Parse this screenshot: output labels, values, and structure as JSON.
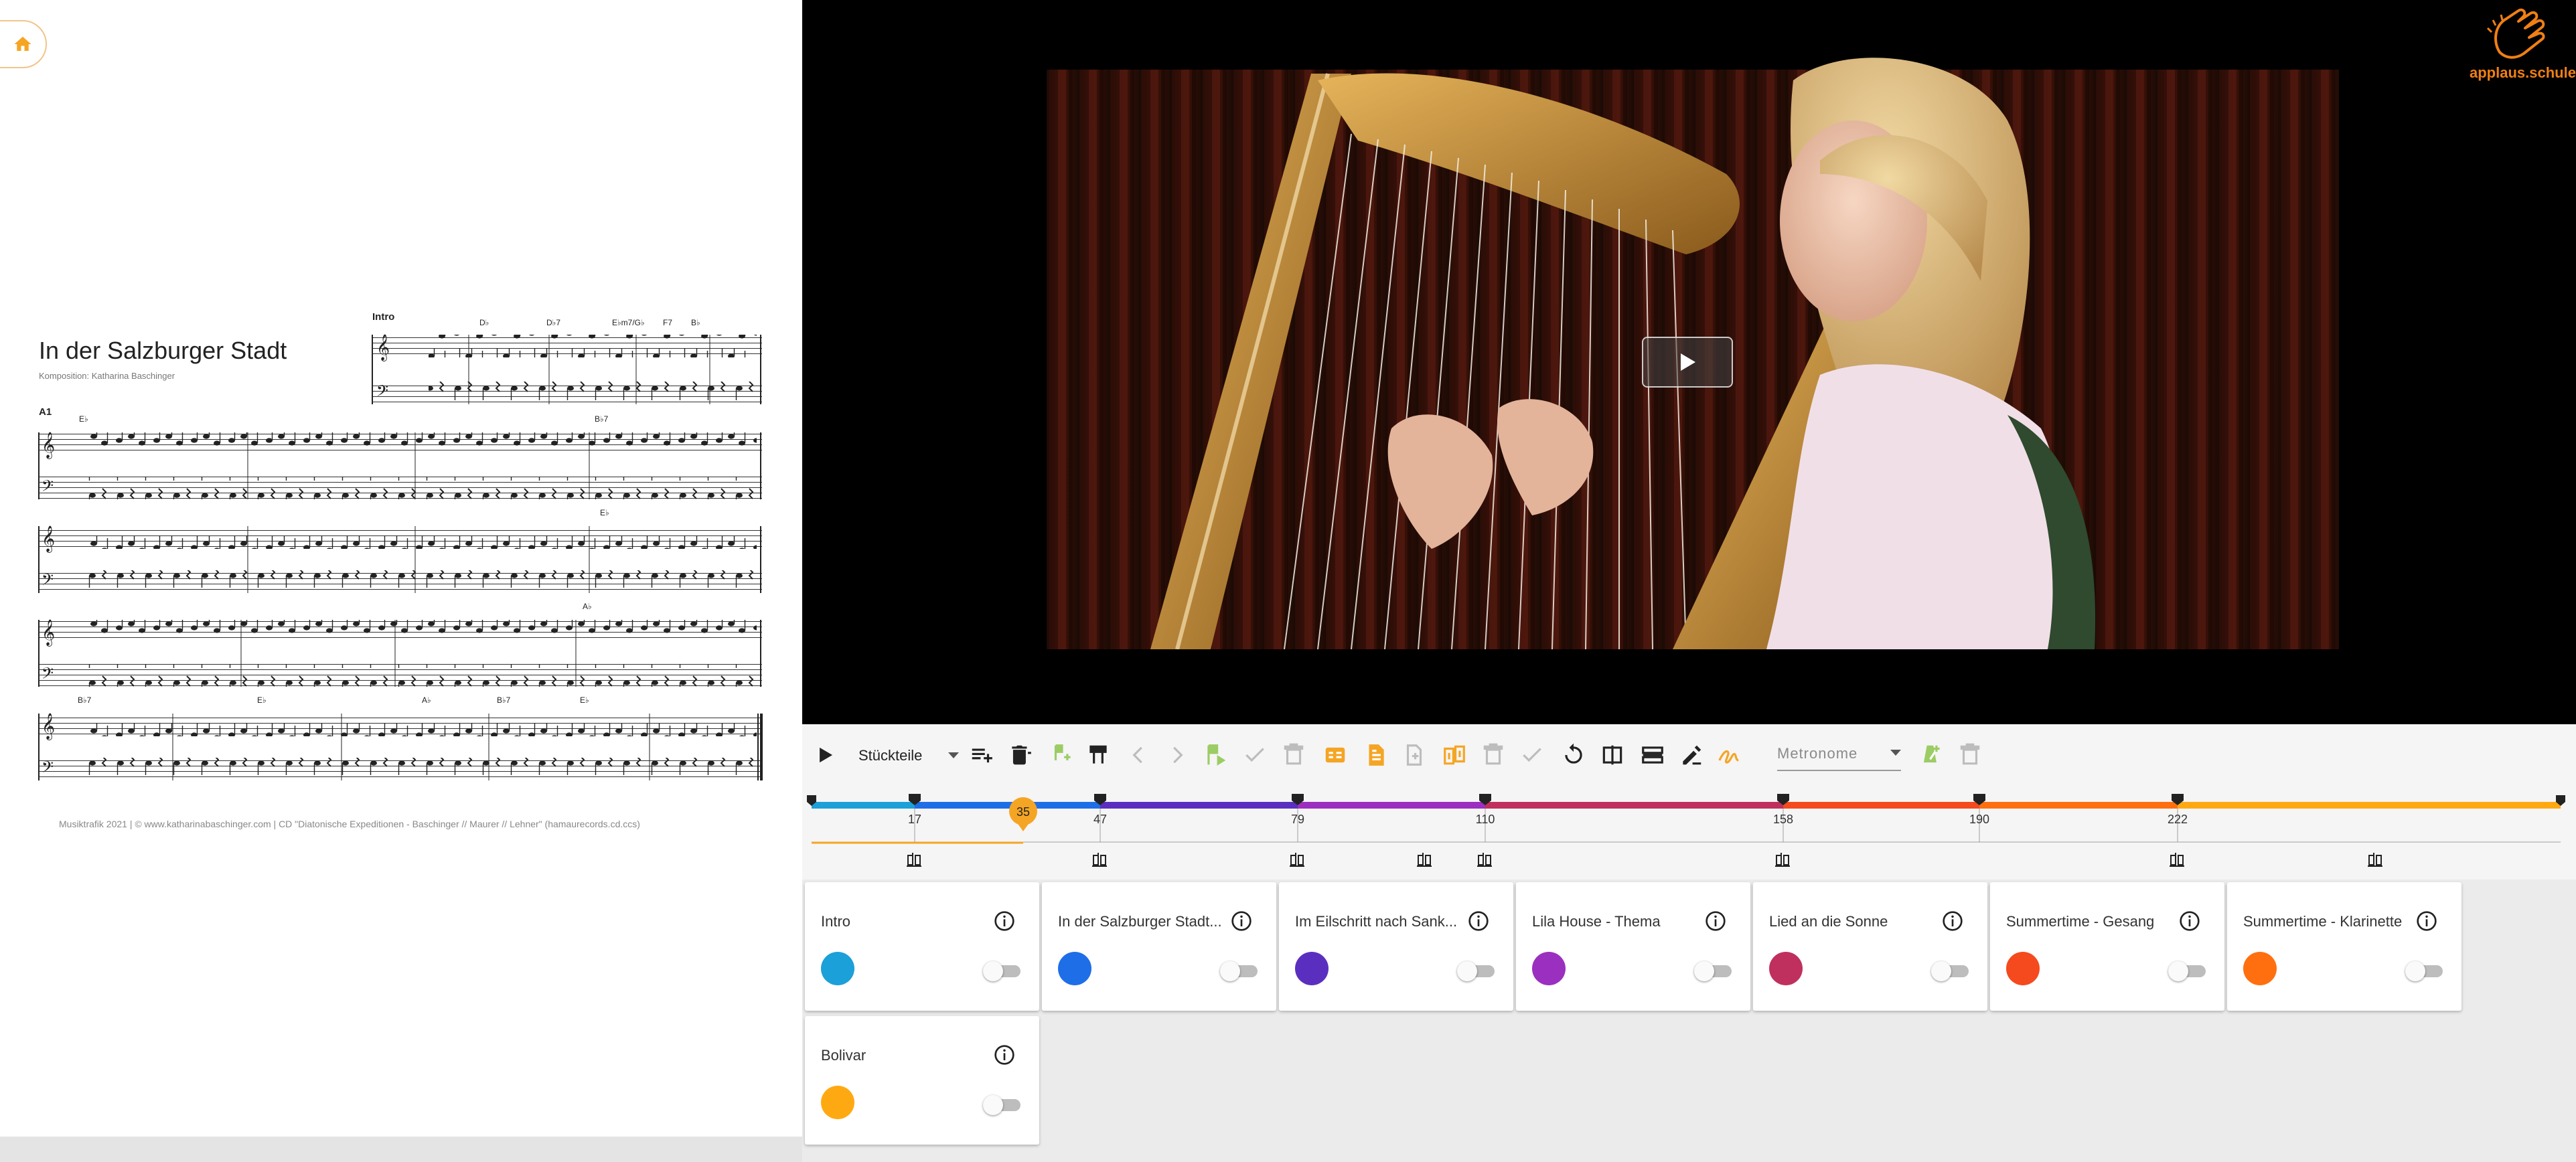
{
  "sheet": {
    "title": "In der Salzburger Stadt",
    "composer": "Komposition: Katharina Baschinger",
    "intro_label": "Intro",
    "section_label": "A1",
    "chords_intro": [
      "D♭",
      "D♭7",
      "E♭m7/G♭",
      "F7",
      "B♭"
    ],
    "chords_row1": [
      "E♭",
      "B♭7"
    ],
    "chords_row2": [
      "E♭"
    ],
    "chords_row3": [
      "A♭"
    ],
    "chords_row4": [
      "B♭7",
      "E♭",
      "A♭",
      "B♭7",
      "E♭"
    ],
    "footer": "Musiktrafik 2021 | © www.katharinabaschinger.com | CD \"Diatonische Expeditionen - Baschinger // Maurer // Lehner\" (hamaurecords.cd.ccs)"
  },
  "logo": {
    "text": "applaus.schule",
    "icon": "clapping-hands-icon",
    "color": "#f07f14"
  },
  "toolbar": {
    "parts_select": "Stückteile",
    "metronome_select": "Metronome"
  },
  "timeline": {
    "position_marker": "35",
    "ticks": [
      "17",
      "47",
      "79",
      "110",
      "158",
      "190",
      "222"
    ],
    "colors": [
      "#1ba0d9",
      "#1e6ee8",
      "#5a2fc0",
      "#9b2fc0",
      "#c0305e",
      "#f44a1e",
      "#ff6f10",
      "#ffa912"
    ]
  },
  "cards": [
    {
      "title": "Intro",
      "color": "#1ba0d9",
      "enabled": false
    },
    {
      "title": "In der Salzburger Stadt...",
      "color": "#1e6ee8",
      "enabled": false
    },
    {
      "title": "Im Eilschritt nach Sank...",
      "color": "#5a2fc0",
      "enabled": false
    },
    {
      "title": "Lila House - Thema",
      "color": "#9b2fc0",
      "enabled": false
    },
    {
      "title": "Lied an die Sonne",
      "color": "#c0305e",
      "enabled": false
    },
    {
      "title": "Summertime - Gesang",
      "color": "#f44a1e",
      "enabled": false
    },
    {
      "title": "Summertime - Klarinette",
      "color": "#ff6f10",
      "enabled": false
    },
    {
      "title": "Bolivar",
      "color": "#ffa912",
      "enabled": false
    }
  ]
}
